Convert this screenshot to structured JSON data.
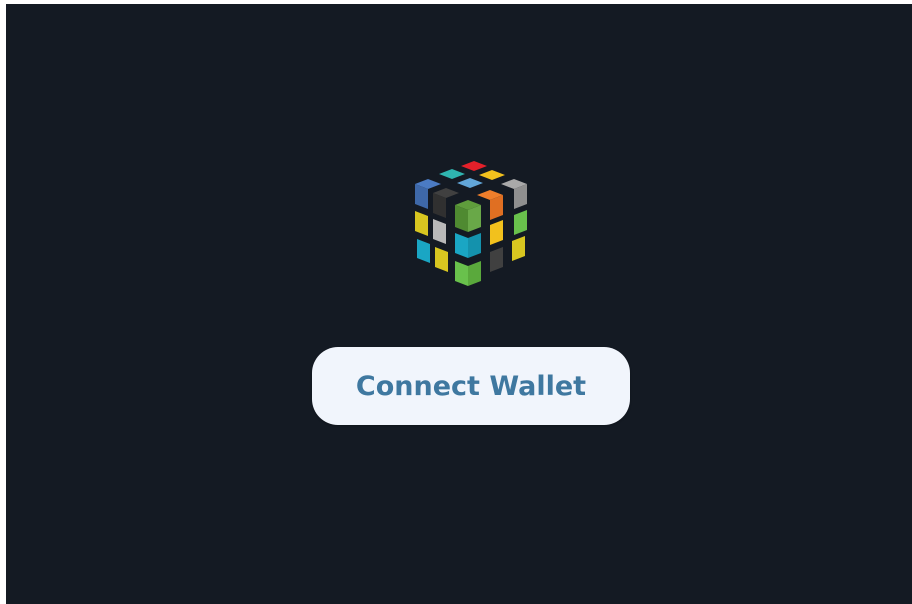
{
  "logo": {
    "icon": "cube-logo-icon",
    "colors": [
      "#e4202a",
      "#2fb5b0",
      "#f2c11d",
      "#4b7bc3",
      "#62a6d9",
      "#a9a9a9",
      "#404040",
      "#5f9d3c",
      "#ef7e2b",
      "#69c14c",
      "#1aa6c4",
      "#d8c620"
    ]
  },
  "wallet": {
    "connect_label": "Connect Wallet"
  },
  "colors": {
    "background": "#141a23",
    "button_bg": "#f1f5fc",
    "button_text": "#3f78a0"
  }
}
